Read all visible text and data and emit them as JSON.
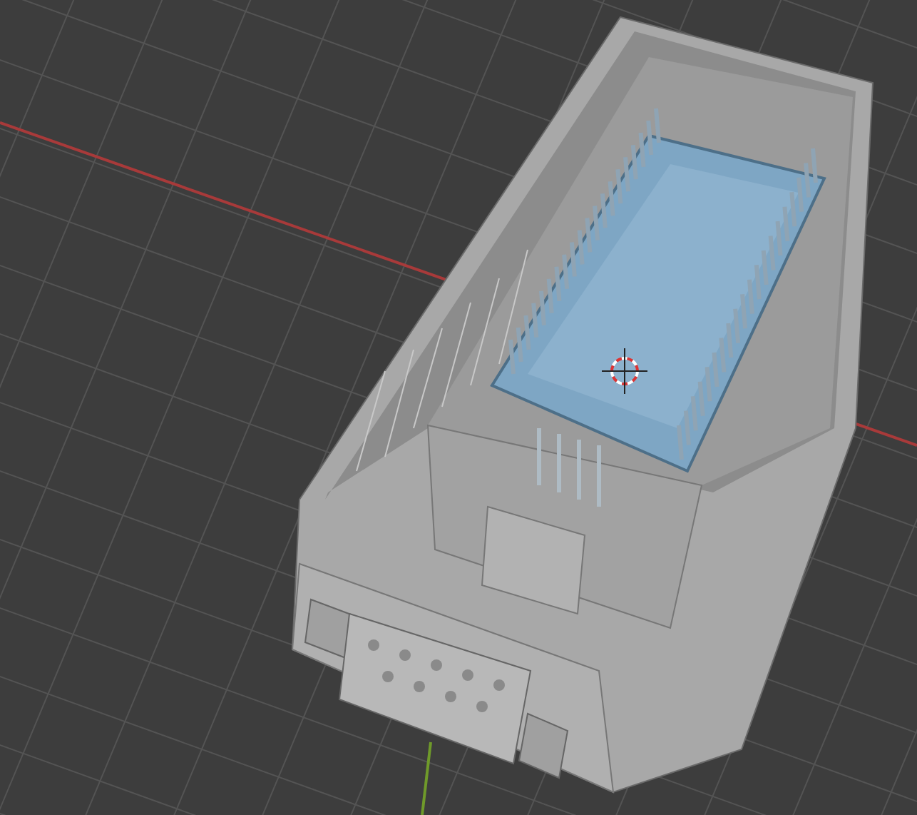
{
  "viewport": {
    "x_axis": true,
    "y_axis": true,
    "cursor": true
  }
}
